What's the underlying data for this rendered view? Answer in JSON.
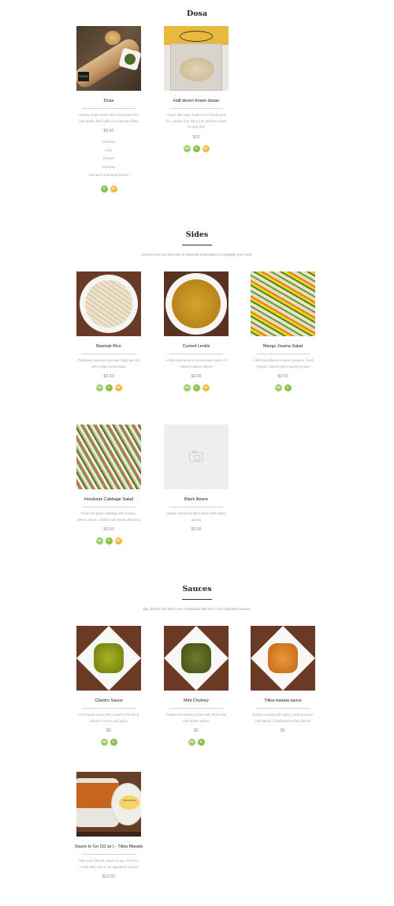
{
  "colors": {
    "vegan": "#9ccc65",
    "vegetarian": "#8bc34a",
    "gluten_free": "#f3b847"
  },
  "dosa": {
    "title": "Dosa",
    "items": [
      {
        "name": "Dosa",
        "desc": "Savory crepe made from fermented rice and lentils, filled with your favorite filling",
        "price": "$6.40",
        "options": [
          "Chicken",
          "Fish",
          "Paneer",
          "Samosa",
          "Spinach and Mushrooms"
        ],
        "badges": [
          "veg",
          "gf"
        ]
      },
      {
        "name": "Half dozen frozen dosas",
        "desc": "Crepe like wrap made out of lentils and rice, gluten free dairy free perfect vessel for any dish",
        "price": "$10",
        "badges": [
          "vgn",
          "veg",
          "gf"
        ]
      }
    ]
  },
  "sides": {
    "title": "Sides",
    "description": "Choose from our selection of delicious small plates to complete your meal.",
    "items": [
      {
        "name": "Basmati Rice",
        "desc": "Delicately steamed aromatic Basmati rice with Indian seasonings",
        "price": "$3.50",
        "badges": [
          "vgn",
          "veg",
          "gf"
        ]
      },
      {
        "name": "Curried Lentils",
        "desc": "Lentils simmered in an aromatic sauce of Indian-inspired spices",
        "price": "$3.50",
        "badges": [
          "vgn",
          "veg",
          "gf"
        ]
      },
      {
        "name": "Mango Jicama Salad",
        "desc": "A delicious blend of sweet peppers, fresh mango, cilantro and crunchy jicama",
        "price": "$3.50",
        "badges": [
          "vgn",
          "veg"
        ]
      },
      {
        "name": "Honduran Cabbage Salad",
        "desc": "Fresh chopped cabbage with tomato, green onions, cilantro and lemon dressing",
        "price": "$3.50",
        "badges": [
          "vgn",
          "veg",
          "gf"
        ]
      },
      {
        "name": "Black Beans",
        "desc": "Slowly simmered black bean with indian spices",
        "price": "$3.50",
        "badges": []
      }
    ]
  },
  "sauces": {
    "title": "Sauces",
    "description": "Dip, drizzle and finish your empanada with one of our signature sauces.",
    "items": [
      {
        "name": "Cilantro Sauce",
        "desc": "Our house sauce with a perfect blend of cilantro, lemon and garlic",
        "price": "$2",
        "badges": [
          "vgn",
          "veg"
        ]
      },
      {
        "name": "Mint Chutney",
        "desc": "Traditional chutney made with fresh mint and Indian spices",
        "price": "$2",
        "badges": [
          "vgn",
          "veg"
        ]
      },
      {
        "name": "Tikka masala sauce",
        "desc": "Bombs mosala with spicy, creamy sauce with blend of traditional Indian flavors",
        "price": "$2",
        "badges": []
      },
      {
        "name": "Sauce to Go (10 oz.) - Tikka Masala",
        "desc": "Take your favorite sauce to go, or feed a crowd with one of our signature sauces",
        "price": "$12.50",
        "badges": []
      }
    ]
  },
  "badge_labels": {
    "vgn": "VG",
    "veg": "V",
    "gf": "GF"
  },
  "photo_text": {
    "dosa_tag": "DOSA",
    "togo_label": "Tikka Masala"
  }
}
